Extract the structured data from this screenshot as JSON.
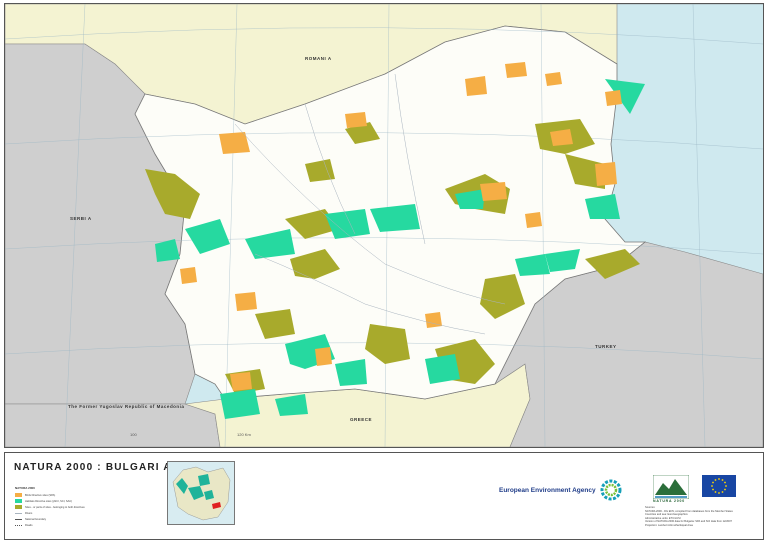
{
  "map": {
    "countries": {
      "romania": "ROMANI A",
      "serbia": "SERBI A",
      "turkey": "TURKEY",
      "macedonia": "The Former Yugoslav Republic of Macedonia",
      "greece": "GREECE"
    },
    "scale": {
      "left": "100",
      "right": "120 Km"
    },
    "colors": {
      "sea": "#cfe9ef",
      "neighbour": "#cfcfcf",
      "romania": "#f4f3d2",
      "greece": "#f4f3d2",
      "bulgaria": "#fdfdf8",
      "sites_birds": "#f5ae45",
      "sites_habitats": "#26d9a0",
      "sites_both": "#a8aa2c"
    }
  },
  "footer": {
    "title": "NATURA 2000 : BULGARI A",
    "legend": {
      "title": "NATURA 2000",
      "items": [
        {
          "label": "Birds Directive sites (SPA)",
          "color": "#f5ae45",
          "kind": "area"
        },
        {
          "label": "Habitats Directive sites (pSCI, SCI, SAC)",
          "color": "#26d9a0",
          "kind": "area"
        },
        {
          "label": "Sites - or parts of sites - belonging to both directives",
          "color": "#a8aa2c",
          "kind": "area"
        },
        {
          "label": "Rivers",
          "kind": "line"
        },
        {
          "label": "National boundary",
          "kind": "line"
        },
        {
          "label": "Roads",
          "kind": "line"
        }
      ]
    },
    "eea_name": "European Environment Agency",
    "natura_logo_text": "NATURA 2000",
    "notes": [
      "Sources:",
      "NATURA 2000 - DG ENV, compiled from databases from the Member States",
      "Countries and sea: EuroGeographics",
      "Administrative units: ETC/LUSI",
      "Version of NATURA 2000 data for Bulgaria: SPA and SCI data from 12/2007",
      "Projection: Lambert Azimuthal Equal Area"
    ]
  }
}
